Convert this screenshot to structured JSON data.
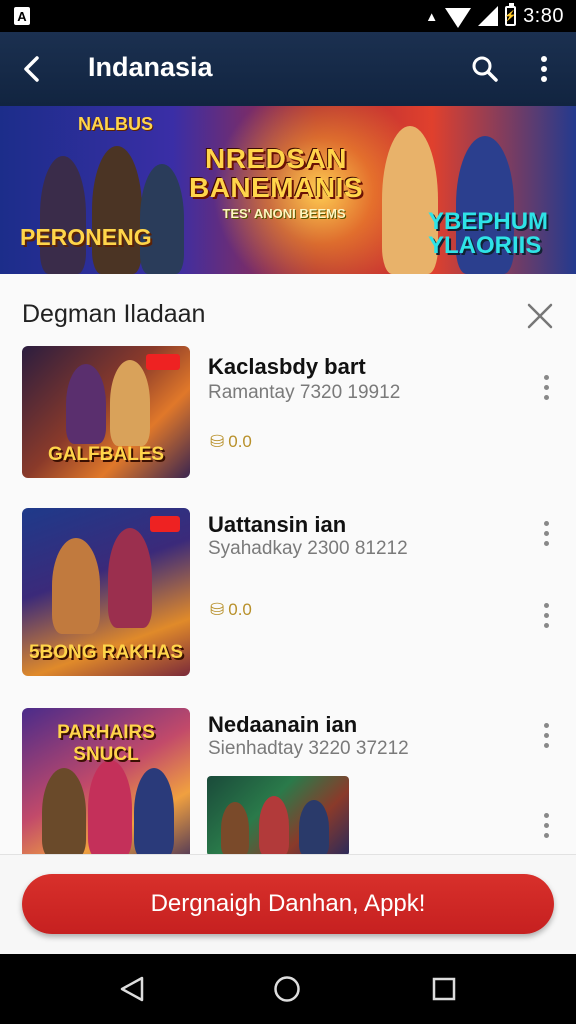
{
  "status_bar": {
    "time": "3:80",
    "notification_icon": "app-a-icon",
    "icons": [
      "alarm-icon",
      "wifi-icon",
      "signal-icon",
      "battery-icon"
    ]
  },
  "app_bar": {
    "title": "Indanasia",
    "back_icon": "back-arrow-icon",
    "search_icon": "search-icon",
    "more_icon": "more-vertical-icon"
  },
  "banner": {
    "title": "NREDSAN BANEMANIS",
    "subtitle": "TES' ANONI BEEMS",
    "left_logo": "PERONENG",
    "top_left_logo": "NALBUS",
    "right_logo": "YBEPHUM YLAORIIS",
    "page_count": 2,
    "active_page": 1
  },
  "sheet": {
    "title": "Degman Iladaan",
    "close_icon": "close-icon",
    "items": [
      {
        "title": "Kaclasbdy bart",
        "subtitle": "Ramantay 7320 19912",
        "meta": "0.0",
        "thumb_label": "GALFBALES"
      },
      {
        "title": "Uattansin ian",
        "subtitle": "Syahadkay 2300 81212",
        "meta": "0.0",
        "thumb_label": "5BONG RAKHAS"
      },
      {
        "title": "Nedaanain ian",
        "subtitle": "Sienhadtay 3220 37212",
        "thumb_label": "PARHAIRS SNUCL"
      }
    ]
  },
  "cta": {
    "label": "Dergnaigh Danhan, Appk!"
  },
  "nav_bar": {
    "icons": [
      "back-triangle-icon",
      "home-circle-icon",
      "recents-square-icon"
    ]
  },
  "colors": {
    "app_bar": "#142a47",
    "cta": "#d12a26",
    "status_bar": "#000000"
  }
}
